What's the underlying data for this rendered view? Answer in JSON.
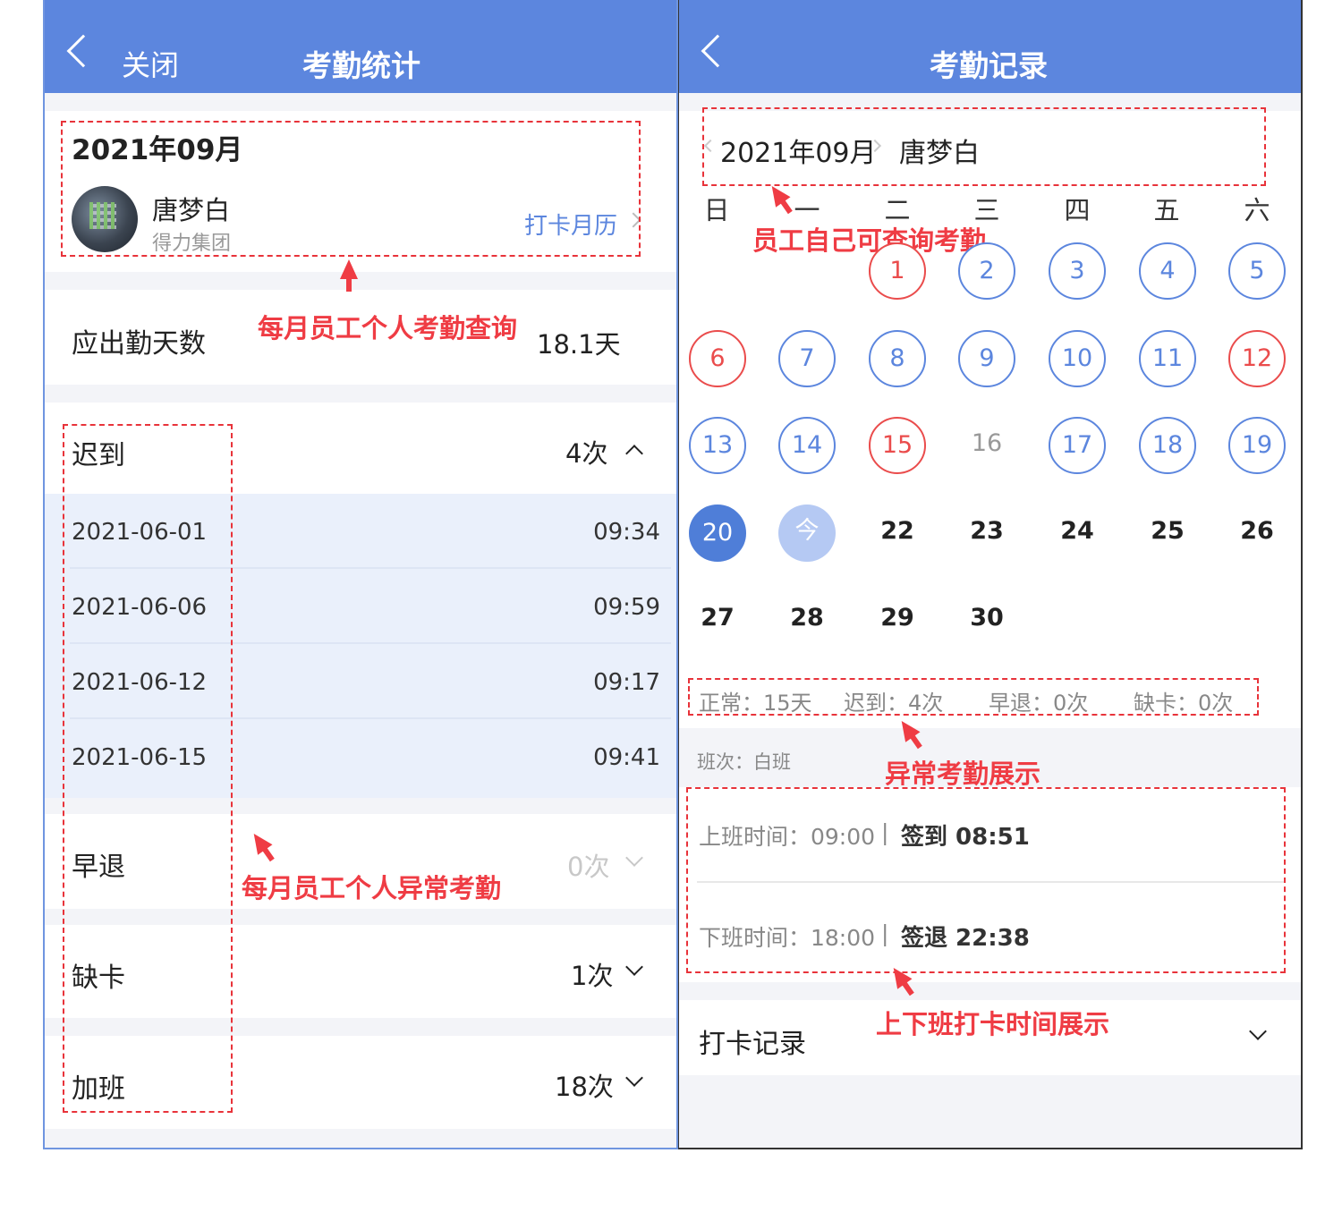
{
  "left": {
    "header": {
      "close_label": "关闭",
      "title": "考勤统计"
    },
    "month": "2021年09月",
    "user": {
      "name": "唐梦白",
      "company": "得力集团"
    },
    "calendar_link": "打卡月历",
    "expected_days": {
      "label": "应出勤天数",
      "value": "18.1天"
    },
    "late": {
      "label": "迟到",
      "count": "4次",
      "records": [
        {
          "date": "2021-06-01",
          "time": "09:34"
        },
        {
          "date": "2021-06-06",
          "time": "09:59"
        },
        {
          "date": "2021-06-12",
          "time": "09:17"
        },
        {
          "date": "2021-06-15",
          "time": "09:41"
        }
      ]
    },
    "early": {
      "label": "早退",
      "count": "0次"
    },
    "missing": {
      "label": "缺卡",
      "count": "1次"
    },
    "overtime": {
      "label": "加班",
      "count": "18次"
    },
    "annotations": {
      "query": "每月员工个人考勤查询",
      "abnormal": "每月员工个人异常考勤"
    }
  },
  "right": {
    "header": {
      "title": "考勤记录"
    },
    "month": "2021年09月",
    "user_name": "唐梦白",
    "weekdays": [
      "日",
      "一",
      "二",
      "三",
      "四",
      "五",
      "六"
    ],
    "days": [
      "1",
      "2",
      "3",
      "4",
      "5",
      "6",
      "7",
      "8",
      "9",
      "10",
      "11",
      "12",
      "13",
      "14",
      "15",
      "16",
      "17",
      "18",
      "19",
      "20",
      "今",
      "22",
      "23",
      "24",
      "25",
      "26",
      "27",
      "28",
      "29",
      "30"
    ],
    "summary": {
      "normal": "正常：15天",
      "late": "迟到：4次",
      "early": "早退：0次",
      "missing": "缺卡：0次"
    },
    "shift": "班次：白班",
    "checkin": {
      "label": "上班时间：09:00",
      "sep": "|",
      "value": "签到 08:51"
    },
    "checkout": {
      "label": "下班时间：18:00",
      "sep": "|",
      "value": "签退 22:38"
    },
    "punch_record": "打卡记录",
    "annotations": {
      "self_query": "员工自己可查询考勤",
      "abnormal": "异常考勤展示",
      "punch_times": "上下班打卡时间展示"
    }
  },
  "colors": {
    "header": "#5c86de",
    "annotation": "#ef3c44",
    "blue_day": "#5c86de",
    "red_day": "#ea4c4c"
  }
}
